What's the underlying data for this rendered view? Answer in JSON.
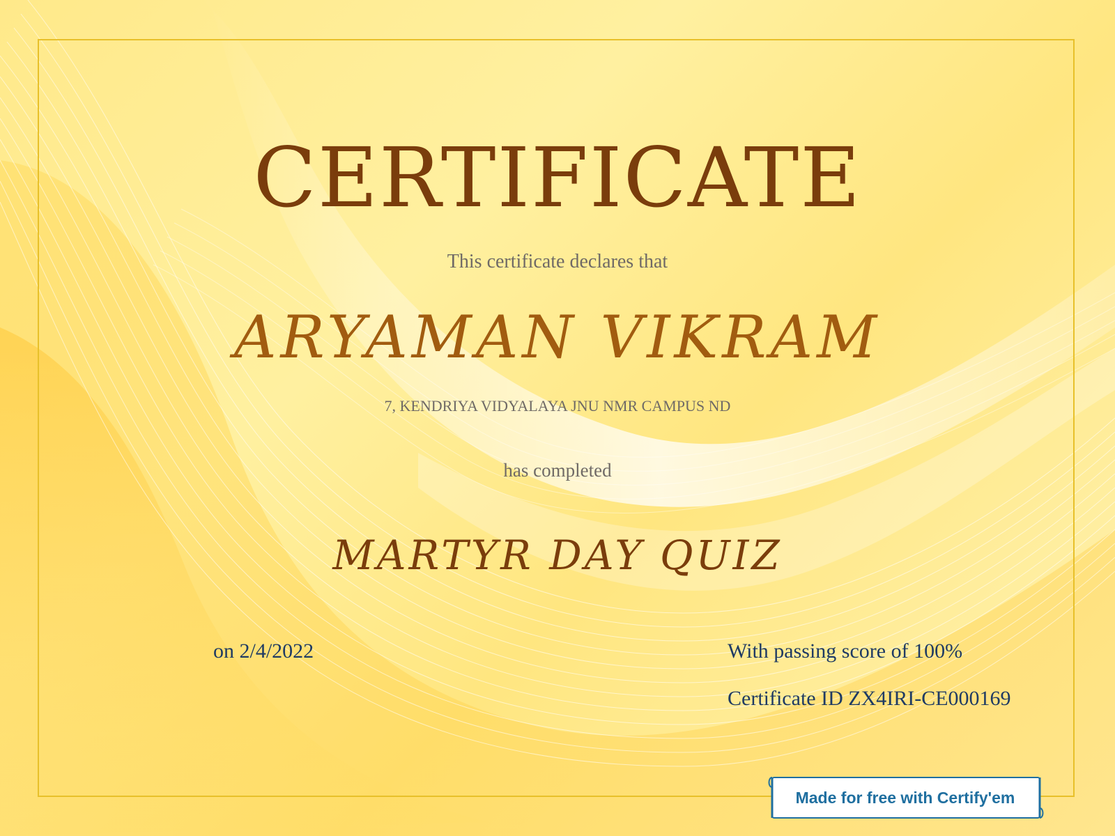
{
  "certificate": {
    "title": "CERTIFICATE",
    "subtitle": "This certificate declares that",
    "recipient": "ARYAMAN VIKRAM",
    "school": "7, KENDRIYA VIDYALAYA JNU NMR CAMPUS ND",
    "completed_text": "has completed",
    "course": "MARTYR DAY QUIZ",
    "date": "on 2/4/2022",
    "score": "With passing score of 100%",
    "certificate_id": "Certificate ID ZX4IRI-CE000169"
  },
  "badge": {
    "label": "Made for free with Certify'em"
  },
  "colors": {
    "background": "#ffe98a",
    "frame": "#e8c02a",
    "title": "#7a3d0c",
    "recipient": "#a15c10",
    "muted_text": "#6f6a66",
    "details_text": "#1f3b63",
    "badge_text": "#1f6fa0"
  }
}
